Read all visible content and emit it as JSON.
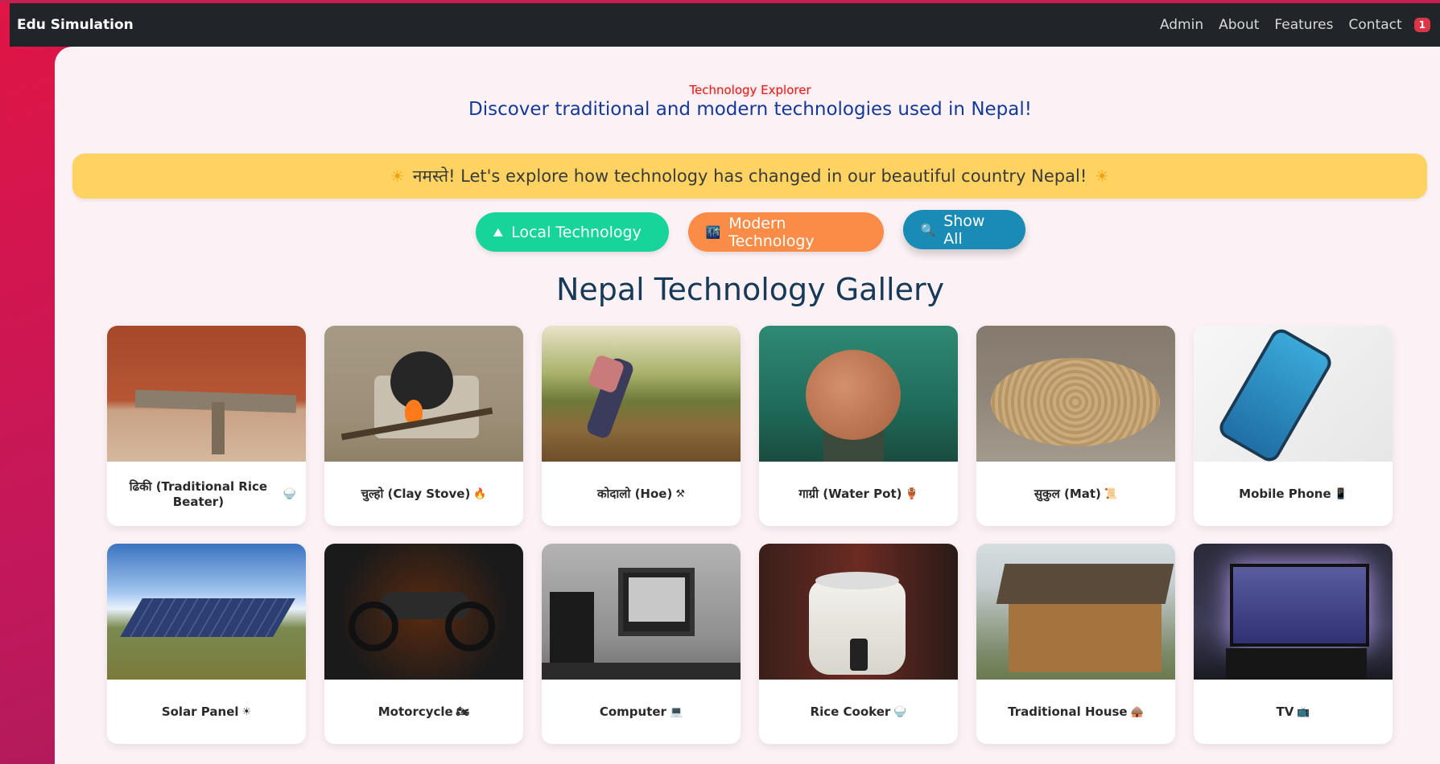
{
  "navbar": {
    "brand": "Edu Simulation",
    "links": [
      "Admin",
      "About",
      "Features",
      "Contact"
    ],
    "badge": "1"
  },
  "header": {
    "subtitle": "Technology Explorer",
    "tagline": "Discover traditional and modern technologies used in Nepal!"
  },
  "banner": {
    "icon": "☀",
    "text": "नमस्ते! Let's explore how technology has changed in our beautiful country Nepal!"
  },
  "filters": [
    {
      "label": "Local Technology",
      "icon": "⛰"
    },
    {
      "label": "Modern Technology",
      "icon": "🌃"
    },
    {
      "label": "Show All",
      "icon": "🔍"
    }
  ],
  "gallery": {
    "title": "Nepal Technology Gallery",
    "items": [
      {
        "label": "ढिकी (Traditional Rice Beater)",
        "emoji": "🍚"
      },
      {
        "label": "चुल्हो (Clay Stove)",
        "emoji": "🔥"
      },
      {
        "label": "कोदालो (Hoe)",
        "emoji": "⚒"
      },
      {
        "label": "गाग्री (Water Pot)",
        "emoji": "🏺"
      },
      {
        "label": "सुकुल (Mat)",
        "emoji": "📜"
      },
      {
        "label": "Mobile Phone",
        "emoji": "📱"
      },
      {
        "label": "Solar Panel",
        "emoji": "☀"
      },
      {
        "label": "Motorcycle",
        "emoji": "🏍"
      },
      {
        "label": "Computer",
        "emoji": "💻"
      },
      {
        "label": "Rice Cooker",
        "emoji": "🍚"
      },
      {
        "label": "Traditional House",
        "emoji": "🛖"
      },
      {
        "label": "TV",
        "emoji": "📺"
      }
    ]
  }
}
